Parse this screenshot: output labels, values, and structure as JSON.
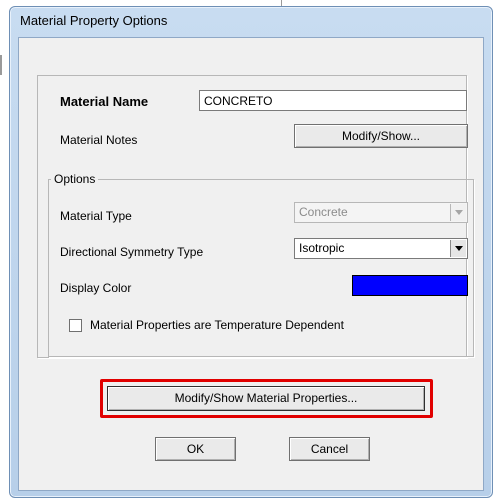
{
  "window": {
    "title": "Material Property Options"
  },
  "material_name": {
    "label": "Material Name",
    "value": "CONCRETO"
  },
  "material_notes": {
    "label": "Material Notes",
    "button_label": "Modify/Show..."
  },
  "options": {
    "title": "Options",
    "material_type": {
      "label": "Material Type",
      "value": "Concrete",
      "enabled": false
    },
    "directional_symmetry": {
      "label": "Directional Symmetry Type",
      "value": "Isotropic"
    },
    "display_color": {
      "label": "Display Color",
      "color": "#0000ff"
    },
    "temperature_dependent": {
      "label": "Material Properties are Temperature Dependent",
      "checked": false
    }
  },
  "buttons": {
    "modify_properties": "Modify/Show Material Properties...",
    "ok": "OK",
    "cancel": "Cancel"
  },
  "highlight_color": "#e10000"
}
